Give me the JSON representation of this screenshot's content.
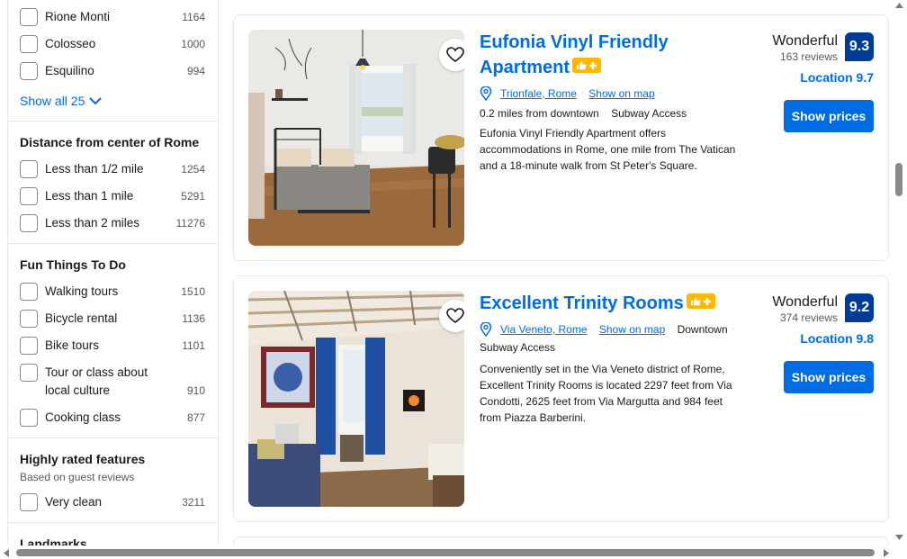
{
  "sidebar": {
    "neighborhoods": [
      {
        "label": "Rione Monti",
        "count": "1164"
      },
      {
        "label": "Colosseo",
        "count": "1000"
      },
      {
        "label": "Esquilino",
        "count": "994"
      }
    ],
    "show_all": "Show all 25",
    "distance": {
      "title": "Distance from center of Rome",
      "options": [
        {
          "label": "Less than 1/2 mile",
          "count": "1254"
        },
        {
          "label": "Less than 1 mile",
          "count": "5291"
        },
        {
          "label": "Less than 2 miles",
          "count": "11276"
        }
      ]
    },
    "fun": {
      "title": "Fun Things To Do",
      "options": [
        {
          "label": "Walking tours",
          "count": "1510"
        },
        {
          "label": "Bicycle rental",
          "count": "1136"
        },
        {
          "label": "Bike tours",
          "count": "1101"
        },
        {
          "label": "Tour or class about local culture",
          "count": "910"
        },
        {
          "label": "Cooking class",
          "count": "877"
        }
      ]
    },
    "features": {
      "title": "Highly rated features",
      "subtitle": "Based on guest reviews",
      "options": [
        {
          "label": "Very clean",
          "count": "3211"
        }
      ]
    },
    "landmarks": {
      "title": "Landmarks"
    }
  },
  "cards": [
    {
      "title_line1": "Eufonia Vinyl Friendly",
      "title_line2": "Apartment",
      "location": "Trionfale, Rome",
      "show_on_map": "Show on map",
      "distance": "0.2 miles from downtown",
      "transit": "Subway Access",
      "description": "Eufonia Vinyl Friendly Apartment offers accommodations in Rome, one mile from The Vatican and a 18-minute walk from St Peter's Square.",
      "rating_word": "Wonderful",
      "reviews": "163 reviews",
      "score": "9.3",
      "location_score": "Location 9.7",
      "button": "Show prices"
    },
    {
      "title_line1": "Excellent Trinity Rooms",
      "location": "Via Veneto, Rome",
      "show_on_map": "Show on map",
      "distance": "Downtown",
      "transit": "Subway Access",
      "description": "Conveniently set in the Via Veneto district of Rome, Excellent Trinity Rooms is located 2297 feet from Via Condotti, 2625 feet from Via Margutta and 984 feet from Piazza Barberini.",
      "rating_word": "Wonderful",
      "reviews": "374 reviews",
      "score": "9.2",
      "location_score": "Location 9.8",
      "button": "Show prices"
    }
  ],
  "colors": {
    "link": "#006ce4",
    "score_bg": "#003b95",
    "badge": "#ffb700"
  },
  "icons": [
    "heart-icon",
    "map-pin-icon",
    "thumbs-up-plus-icon",
    "chevron-down-icon"
  ]
}
